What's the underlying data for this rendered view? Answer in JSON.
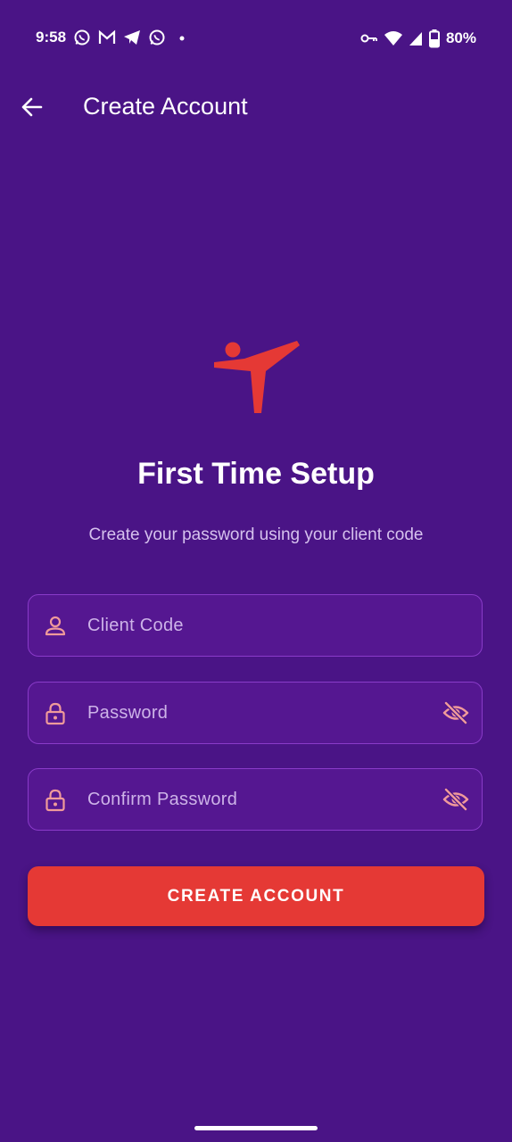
{
  "status_bar": {
    "time": "9:58",
    "battery": "80%",
    "left_icons": [
      "whatsapp-icon",
      "gmail-icon",
      "telegram-icon",
      "whatsapp-icon",
      "dot-icon"
    ],
    "right_icons": [
      "vpn-key-icon",
      "wifi-icon",
      "signal-icon",
      "battery-saver-icon"
    ]
  },
  "app_bar": {
    "title": "Create Account",
    "back_icon": "arrow-left-icon"
  },
  "logo": {
    "icon": "martial-arts-kick-icon",
    "color": "#e53935"
  },
  "setup": {
    "title": "First Time Setup",
    "subtitle": "Create your password using your client code"
  },
  "form": {
    "client_code": {
      "placeholder": "Client Code",
      "value": "",
      "icon": "person-icon"
    },
    "password": {
      "placeholder": "Password",
      "value": "",
      "icon": "lock-icon",
      "toggle_icon": "eye-off-icon"
    },
    "confirm_password": {
      "placeholder": "Confirm Password",
      "value": "",
      "icon": "lock-icon",
      "toggle_icon": "eye-off-icon"
    },
    "submit_label": "CREATE ACCOUNT"
  },
  "colors": {
    "background": "#4a1486",
    "field_background": "#551791",
    "field_border": "#8a3bc9",
    "accent": "#e53935",
    "icon_tint": "#f09a9a",
    "subtitle": "#d6c2ee"
  }
}
